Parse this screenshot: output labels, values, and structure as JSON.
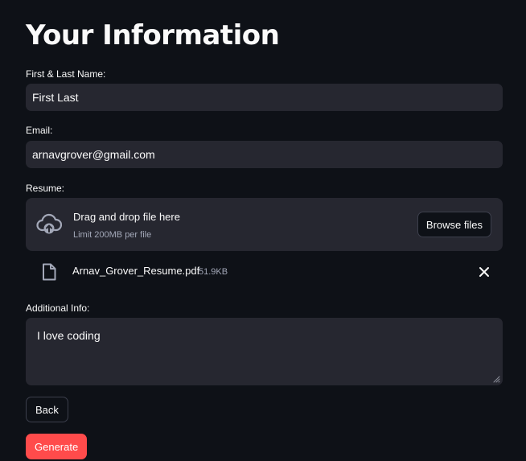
{
  "page": {
    "title": "Your Information"
  },
  "name_field": {
    "label": "First & Last Name:",
    "value": "First Last"
  },
  "email_field": {
    "label": "Email:",
    "value": "arnavgrover@gmail.com"
  },
  "resume": {
    "label": "Resume:",
    "dropzone_title": "Drag and drop file here",
    "dropzone_limit": "Limit 200MB per file",
    "browse_label": "Browse files",
    "file_name": "Arnav_Grover_Resume.pdf",
    "file_size": "51.9KB"
  },
  "additional_info": {
    "label": "Additional Info:",
    "value": "I love coding"
  },
  "buttons": {
    "back_label": "Back",
    "generate_label": "Generate"
  },
  "colors": {
    "background": "#0e1117",
    "field": "#262730",
    "primary": "#ff4b4b",
    "muted_text": "#a3a8b8"
  },
  "icons": {
    "upload": "cloud-upload-icon",
    "file": "file-icon",
    "remove": "close-icon"
  }
}
